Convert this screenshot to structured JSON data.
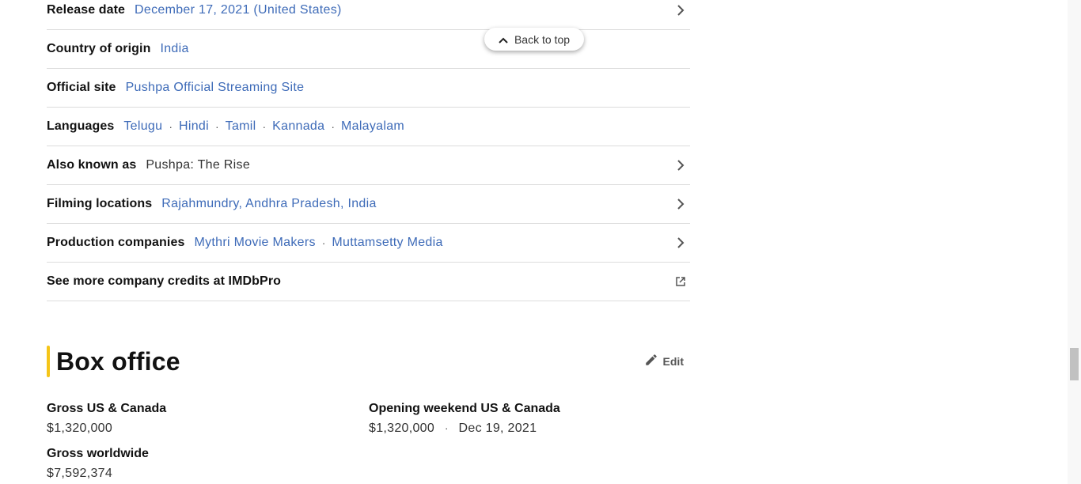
{
  "details": {
    "release_date": {
      "label": "Release date",
      "value": "December 17, 2021 (United States)"
    },
    "country": {
      "label": "Country of origin",
      "value": "India"
    },
    "official_site": {
      "label": "Official site",
      "value": "Pushpa Official Streaming Site"
    },
    "languages": {
      "label": "Languages",
      "values": [
        "Telugu",
        "Hindi",
        "Tamil",
        "Kannada",
        "Malayalam"
      ]
    },
    "aka": {
      "label": "Also known as",
      "value": "Pushpa: The Rise"
    },
    "filming": {
      "label": "Filming locations",
      "value": "Rajahmundry, Andhra Pradesh, India"
    },
    "production": {
      "label": "Production companies",
      "values": [
        "Mythri Movie Makers",
        "Muttamsetty Media"
      ]
    },
    "imdbpro": {
      "label": "See more company credits at IMDbPro"
    }
  },
  "back_to_top": {
    "label": "Back to top",
    "icon": "chevron-up-icon"
  },
  "box_office": {
    "title": "Box office",
    "edit_label": "Edit",
    "gross_us": {
      "label": "Gross US & Canada",
      "value": "$1,320,000"
    },
    "opening": {
      "label": "Opening weekend US & Canada",
      "value": "$1,320,000",
      "date": "Dec 19, 2021"
    },
    "gross_world": {
      "label": "Gross worldwide",
      "value": "$7,592,374"
    }
  },
  "colors": {
    "accent": "#f5c518",
    "link": "#3e6bb8"
  }
}
